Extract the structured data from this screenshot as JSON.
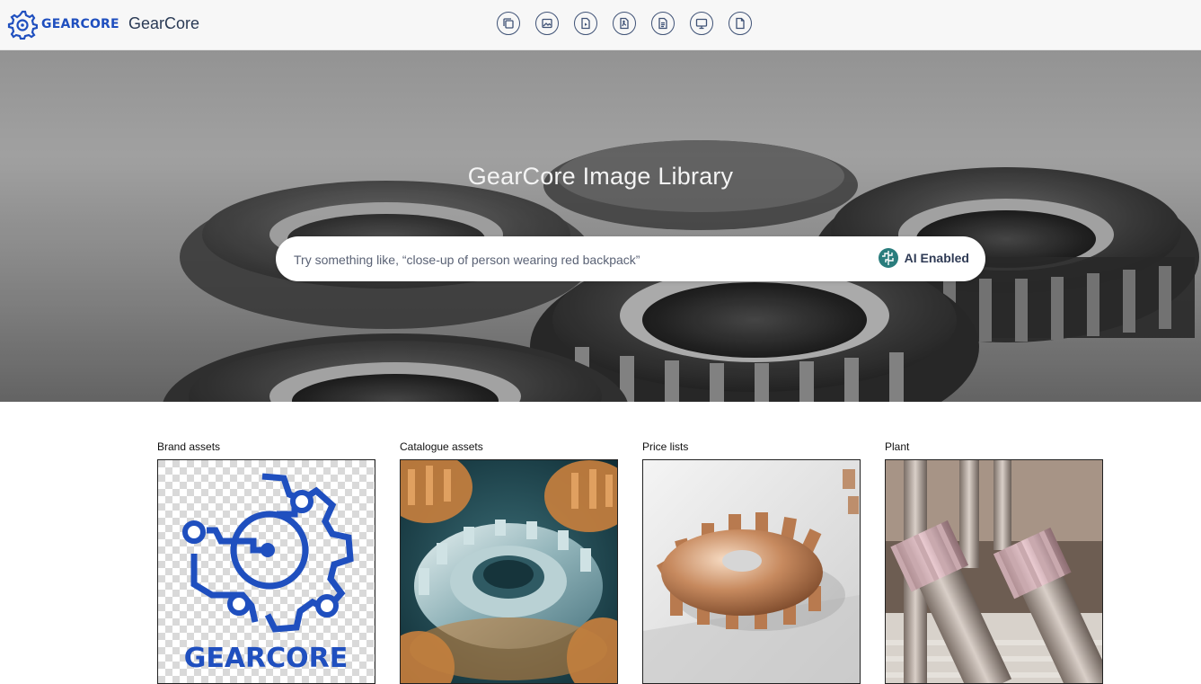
{
  "header": {
    "logo_text": "GEARCORE",
    "app_name": "GearCore",
    "tools": [
      {
        "icon": "collections-icon"
      },
      {
        "icon": "image-icon"
      },
      {
        "icon": "video-icon"
      },
      {
        "icon": "pdf-icon"
      },
      {
        "icon": "document-icon"
      },
      {
        "icon": "presentation-icon"
      },
      {
        "icon": "file-icon"
      }
    ]
  },
  "hero": {
    "title": "GearCore Image Library",
    "search": {
      "placeholder": "Try something like, “close-up of person wearing red backpack”",
      "value": ""
    },
    "ai_badge": {
      "icon": "ai-brain-icon",
      "label": "AI Enabled"
    }
  },
  "collections": [
    {
      "label": "Brand assets",
      "thumbnail": "gearcore-logo",
      "thumbnail_text": "GEARCORE"
    },
    {
      "label": "Catalogue assets",
      "thumbnail": "teal-gear-closeup"
    },
    {
      "label": "Price lists",
      "thumbnail": "copper-gear"
    },
    {
      "label": "Plant",
      "thumbnail": "gear-shafts"
    }
  ],
  "colors": {
    "brand_blue": "#1f4fbf",
    "nav_icon": "#3f5276",
    "ai_teal": "#2a7d7d"
  }
}
